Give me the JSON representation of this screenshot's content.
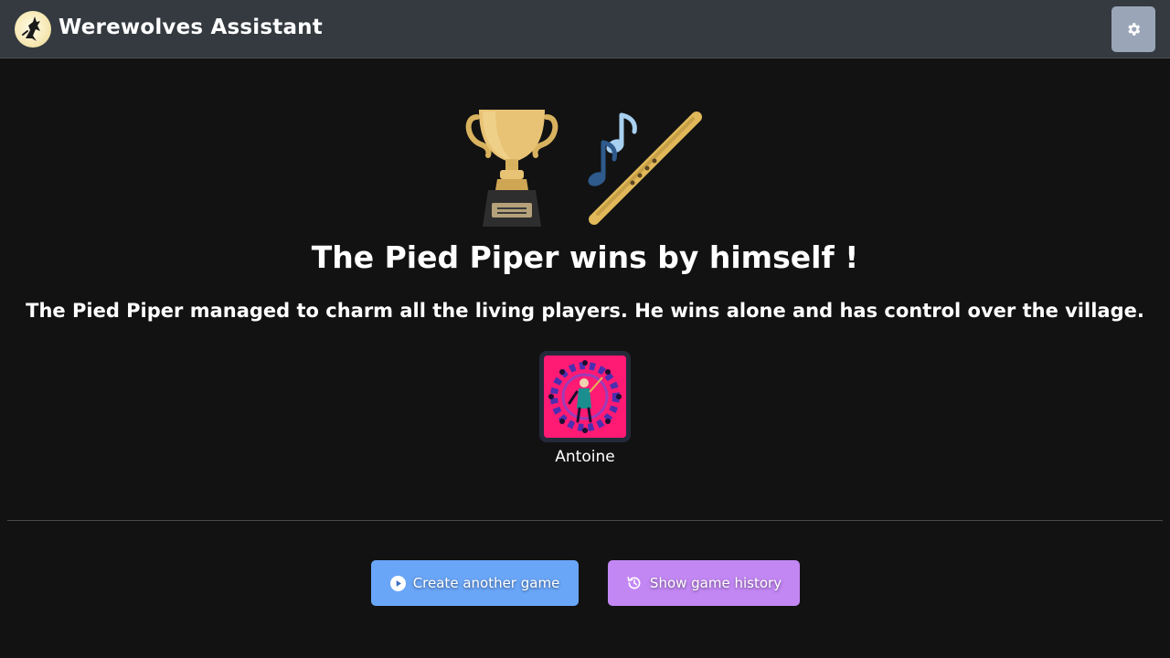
{
  "header": {
    "title": "Werewolves Assistant",
    "logo_icon": "werewolf-moon-logo",
    "settings_icon": "gear-icon"
  },
  "result": {
    "icons": [
      "trophy-icon",
      "flute-icon"
    ],
    "headline": "The Pied Piper wins by himself !",
    "description": "The Pied Piper managed to charm all the living players. He wins alone and has control over the village."
  },
  "winners": [
    {
      "name": "Antoine",
      "role_icon": "pied-piper-role-icon"
    }
  ],
  "actions": {
    "create_label": "Create another game",
    "create_icon": "play-circle-icon",
    "history_label": "Show game history",
    "history_icon": "history-icon"
  },
  "colors": {
    "topbar": "#343a40",
    "background": "#121212",
    "create_button": "#6aa6f8",
    "history_button": "#c387f4",
    "settings_button": "#9aa6b8",
    "avatar_background": "#ff1a74"
  }
}
